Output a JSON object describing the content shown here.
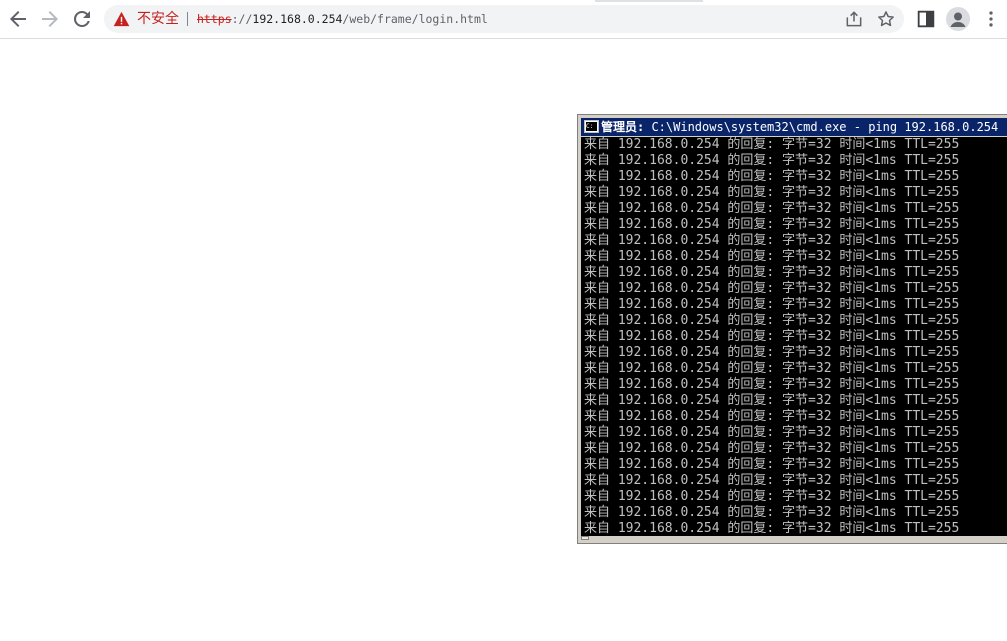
{
  "browser": {
    "toolbar": {
      "back_icon": "arrow-left-icon",
      "forward_icon": "arrow-right-icon",
      "reload_icon": "reload-icon",
      "share_icon": "share-icon",
      "bookmark_icon": "star-icon",
      "side_panel_icon": "side-panel-icon",
      "profile_icon": "avatar-icon",
      "menu_icon": "kebab-menu-icon"
    },
    "omnibox": {
      "security_icon": "warning-triangle-icon",
      "security_label": "不安全",
      "url_scheme": "https",
      "url_separator": "://",
      "url_host": "192.168.0.254",
      "url_path": "/web/frame/login.html"
    },
    "colors": {
      "warning": "#c5221f",
      "chrome_bg": "#ffffff",
      "omnibox_bg": "#f1f3f4"
    }
  },
  "cmd_window": {
    "title_prefix": "管理员:",
    "title_rest": " C:\\Windows\\system32\\cmd.exe - ping  192.168.0.254 -",
    "icon": "cmd-icon",
    "colors": {
      "titlebar": "#0a246a",
      "console_bg": "#000000",
      "console_text": "#c0c0c0"
    },
    "lines": [
      "来自 192.168.0.254 的回复: 字节=32 时间<1ms TTL=255",
      "来自 192.168.0.254 的回复: 字节=32 时间<1ms TTL=255",
      "来自 192.168.0.254 的回复: 字节=32 时间<1ms TTL=255",
      "来自 192.168.0.254 的回复: 字节=32 时间<1ms TTL=255",
      "来自 192.168.0.254 的回复: 字节=32 时间<1ms TTL=255",
      "来自 192.168.0.254 的回复: 字节=32 时间<1ms TTL=255",
      "来自 192.168.0.254 的回复: 字节=32 时间<1ms TTL=255",
      "来自 192.168.0.254 的回复: 字节=32 时间<1ms TTL=255",
      "来自 192.168.0.254 的回复: 字节=32 时间<1ms TTL=255",
      "来自 192.168.0.254 的回复: 字节=32 时间<1ms TTL=255",
      "来自 192.168.0.254 的回复: 字节=32 时间<1ms TTL=255",
      "来自 192.168.0.254 的回复: 字节=32 时间<1ms TTL=255",
      "来自 192.168.0.254 的回复: 字节=32 时间<1ms TTL=255",
      "来自 192.168.0.254 的回复: 字节=32 时间<1ms TTL=255",
      "来自 192.168.0.254 的回复: 字节=32 时间<1ms TTL=255",
      "来自 192.168.0.254 的回复: 字节=32 时间<1ms TTL=255",
      "来自 192.168.0.254 的回复: 字节=32 时间<1ms TTL=255",
      "来自 192.168.0.254 的回复: 字节=32 时间<1ms TTL=255",
      "来自 192.168.0.254 的回复: 字节=32 时间<1ms TTL=255",
      "来自 192.168.0.254 的回复: 字节=32 时间<1ms TTL=255",
      "来自 192.168.0.254 的回复: 字节=32 时间<1ms TTL=255",
      "来自 192.168.0.254 的回复: 字节=32 时间<1ms TTL=255",
      "来自 192.168.0.254 的回复: 字节=32 时间<1ms TTL=255",
      "来自 192.168.0.254 的回复: 字节=32 时间<1ms TTL=255",
      "来自 192.168.0.254 的回复: 字节=32 时间<1ms TTL=255"
    ]
  }
}
